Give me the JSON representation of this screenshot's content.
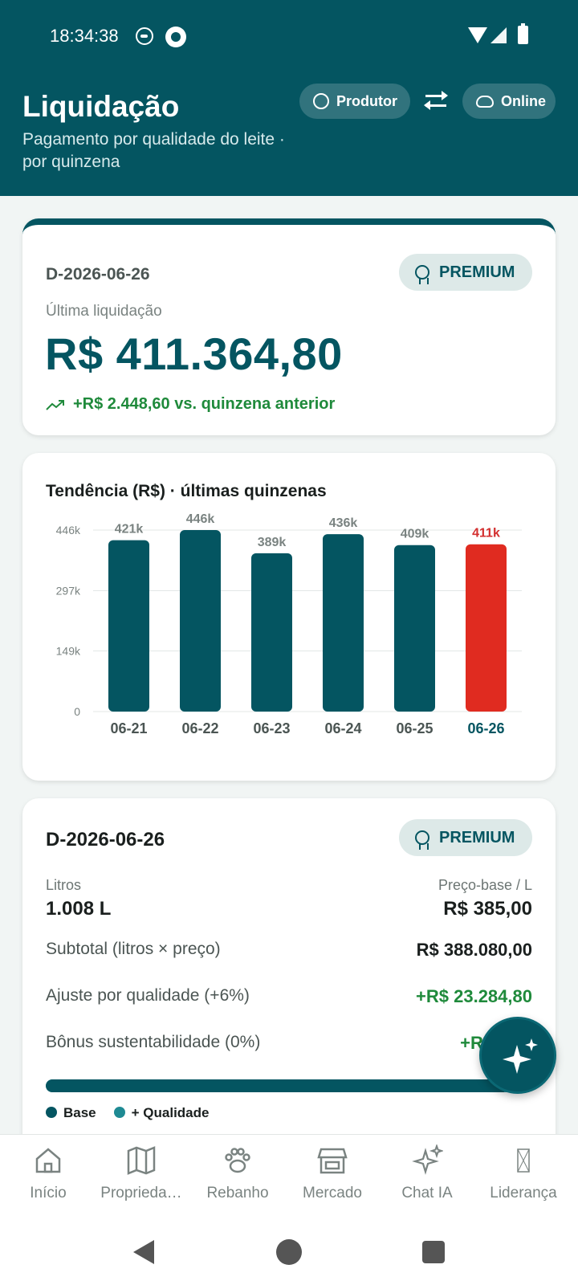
{
  "status_bar": {
    "time": "18:34:38"
  },
  "header": {
    "title": "Liquidação",
    "subtitle": "Pagamento por qualidade do leite · por quinzena",
    "role_chip": "Produtor",
    "connection_chip": "Online"
  },
  "summary": {
    "code": "D-2026-06-26",
    "badge": "PREMIUM",
    "label": "Última liquidação",
    "amount": "R$ 411.364,80",
    "delta": "+R$ 2.448,60 vs. quinzena anterior"
  },
  "trend": {
    "title": "Tendência (R$) · últimas quinzenas"
  },
  "chart_data": {
    "type": "bar",
    "categories": [
      "06-21",
      "06-22",
      "06-23",
      "06-24",
      "06-25",
      "06-26"
    ],
    "values": [
      421000,
      446000,
      389000,
      436000,
      409000,
      411000
    ],
    "value_labels": [
      "421k",
      "446k",
      "389k",
      "436k",
      "409k",
      "411k"
    ],
    "y_ticks": [
      0,
      149000,
      297000,
      446000
    ],
    "y_tick_labels": [
      "0",
      "149k",
      "297k",
      "446k"
    ],
    "ylim": [
      0,
      446000
    ],
    "highlight_index": 5,
    "colors": {
      "bar": "#045561",
      "highlight": "#e02b20",
      "highlight_label": "#d32f2f"
    },
    "grid": true
  },
  "detail": {
    "code": "D-2026-06-26",
    "badge": "PREMIUM",
    "liters_label": "Litros",
    "liters_value": "1.008 L",
    "price_label": "Preço-base / L",
    "price_value": "R$ 385,00",
    "subtotal_label": "Subtotal (litros × preço)",
    "subtotal_value": "R$ 388.080,00",
    "quality_label": "Ajuste por qualidade (+6%)",
    "quality_value": "+R$ 23.284,80",
    "bonus_label": "Bônus sustentabilidade (0%)",
    "bonus_value": "+R$ 0,00",
    "base_fraction": 0.943,
    "legend": [
      "Base",
      "+ Qualidade"
    ]
  },
  "nav": {
    "items": [
      {
        "label": "Início",
        "icon": "home-icon"
      },
      {
        "label": "Proprieda…",
        "icon": "map-icon"
      },
      {
        "label": "Rebanho",
        "icon": "paw-icon"
      },
      {
        "label": "Mercado",
        "icon": "store-icon"
      },
      {
        "label": "Chat IA",
        "icon": "sparkles-icon"
      },
      {
        "label": "Liderança",
        "icon": "leadership-icon"
      }
    ]
  },
  "colors": {
    "primary": "#045561",
    "positive": "#1f8a3b",
    "accent": "#1e8a93"
  }
}
